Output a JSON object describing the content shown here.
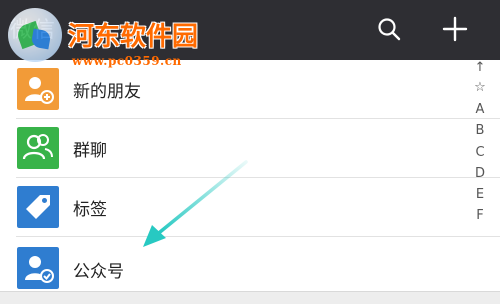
{
  "header": {
    "title": "微信",
    "search_icon": "search-icon",
    "add_icon": "plus-icon"
  },
  "watermark": {
    "name": "河东软件园",
    "url": "www.pc0359.cn"
  },
  "contacts": {
    "items": [
      {
        "label": "新的朋友",
        "icon": "add-friend-icon",
        "color": "#f29b38"
      },
      {
        "label": "群聊",
        "icon": "group-chat-icon",
        "color": "#38b349"
      },
      {
        "label": "标签",
        "icon": "tag-icon",
        "color": "#2f7dd0"
      },
      {
        "label": "公众号",
        "icon": "official-account-icon",
        "color": "#2f7dd0"
      }
    ]
  },
  "index_bar": {
    "up": "↑",
    "star": "☆",
    "letters": [
      "A",
      "B",
      "C",
      "D",
      "E",
      "F"
    ]
  },
  "colors": {
    "header_bg": "#2e2e33",
    "arrow": "#27c9c2",
    "watermark_text": "#ff6a00"
  }
}
